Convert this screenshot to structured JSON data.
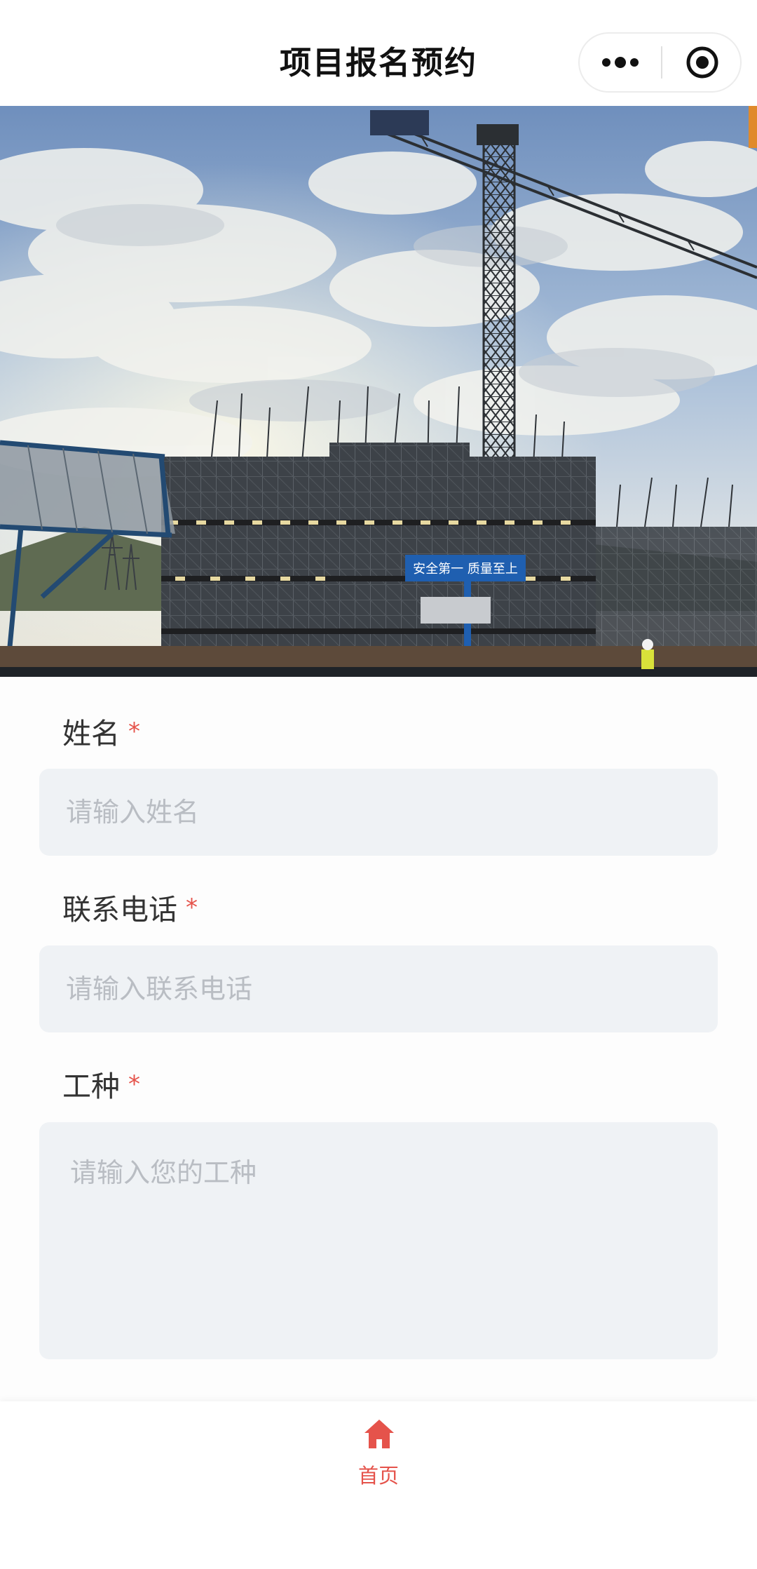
{
  "nav": {
    "title": "项目报名预约",
    "more_icon": "more-dots-icon",
    "close_icon": "mini-program-close-icon"
  },
  "banner": {
    "sign_text": "安全第一 质量至上"
  },
  "form": {
    "name": {
      "label": "姓名",
      "required_mark": "*",
      "placeholder": "请输入姓名"
    },
    "phone": {
      "label": "联系电话",
      "required_mark": "*",
      "placeholder": "请输入联系电话"
    },
    "trade": {
      "label": "工种",
      "required_mark": "*",
      "placeholder": "请输入您的工种"
    }
  },
  "tabbar": {
    "home_label": "首页",
    "home_icon": "home-icon",
    "active_color": "#e5534b"
  },
  "colors": {
    "accent": "#e5534b",
    "input_bg": "#eff2f5",
    "placeholder": "#b9bdc3"
  }
}
